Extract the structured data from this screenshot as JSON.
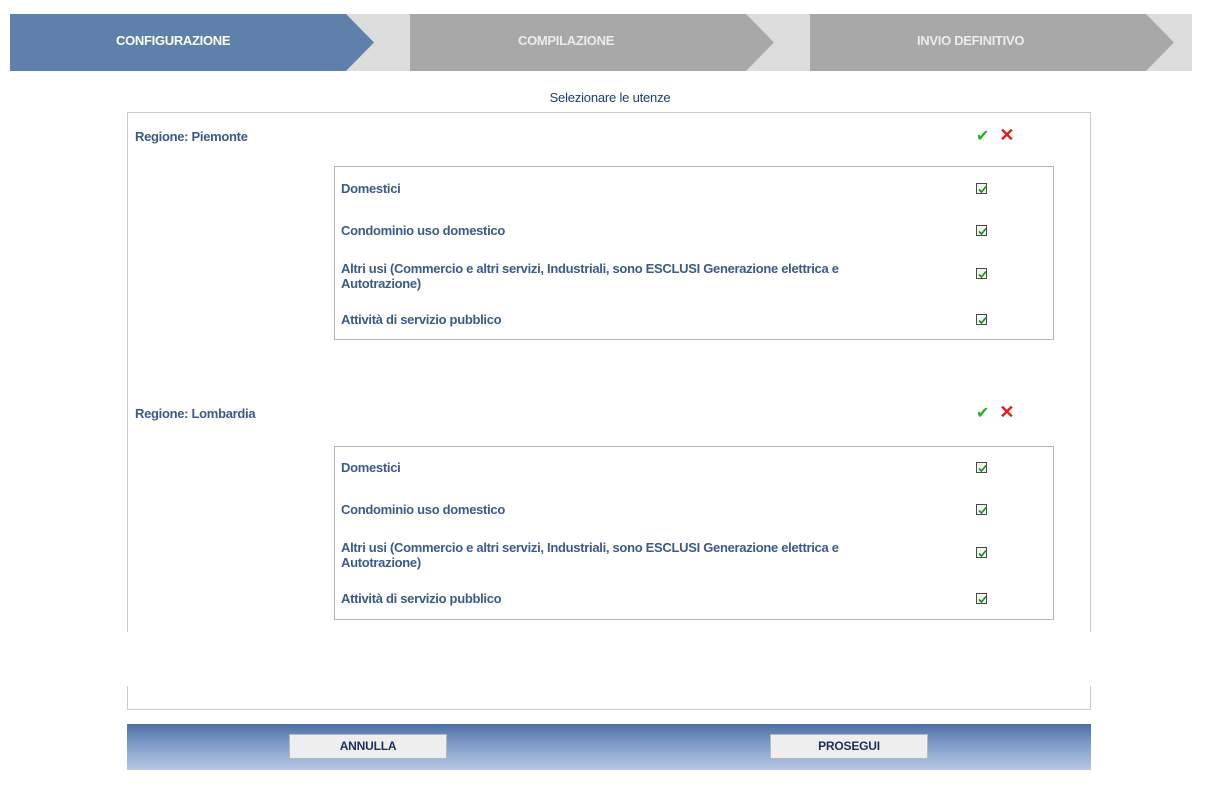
{
  "stepper": {
    "steps": [
      {
        "label": "CONFIGURAZIONE",
        "state": "active"
      },
      {
        "label": "COMPILAZIONE",
        "state": "inactive"
      },
      {
        "label": "INVIO DEFINITIVO",
        "state": "inactive"
      }
    ],
    "colors": {
      "active": "#5f80ab",
      "inactive": "#a8a8a8",
      "background": "#dcdcdc"
    }
  },
  "page_title": "Selezionare le utenze",
  "regions": [
    {
      "label": "Regione: Piemonte",
      "select_all_icon": "check-icon",
      "deselect_all_icon": "cross-icon",
      "items": [
        {
          "label": "Domestici",
          "checked": true
        },
        {
          "label": "Condominio uso domestico",
          "checked": true
        },
        {
          "label": "Altri usi (Commercio e altri servizi, Industriali, sono ESCLUSI Generazione elettrica e Autotrazione)",
          "checked": true
        },
        {
          "label": "Attività di servizio pubblico",
          "checked": true
        }
      ]
    },
    {
      "label": "Regione: Lombardia",
      "select_all_icon": "check-icon",
      "deselect_all_icon": "cross-icon",
      "items": [
        {
          "label": "Domestici",
          "checked": true
        },
        {
          "label": "Condominio uso domestico",
          "checked": true
        },
        {
          "label": "Altri usi (Commercio e altri servizi, Industriali, sono ESCLUSI Generazione elettrica e Autotrazione)",
          "checked": true
        },
        {
          "label": "Attività di servizio pubblico",
          "checked": true
        }
      ]
    }
  ],
  "footer": {
    "cancel_label": "ANNULLA",
    "continue_label": "PROSEGUI"
  }
}
